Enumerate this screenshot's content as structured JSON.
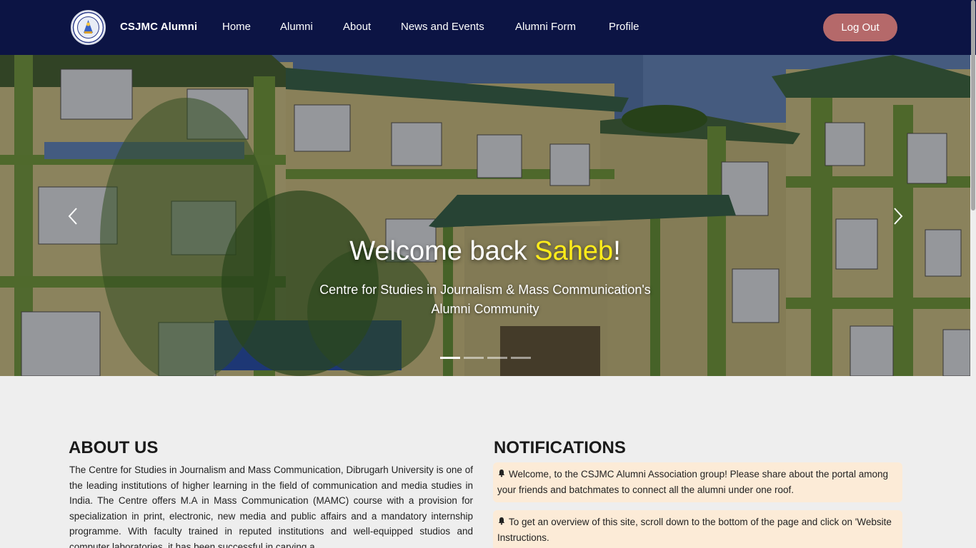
{
  "navbar": {
    "brand": "CSJMC Alumni",
    "links": [
      {
        "label": "Home"
      },
      {
        "label": "Alumni"
      },
      {
        "label": "About"
      },
      {
        "label": "News and Events"
      },
      {
        "label": "Alumni Form"
      },
      {
        "label": "Profile"
      }
    ],
    "logout_label": "Log Out"
  },
  "hero": {
    "welcome_prefix": "Welcome back ",
    "user_name": "Saheb",
    "welcome_suffix": "!",
    "subtitle_line1": "Centre for Studies in Journalism & Mass Communication's",
    "subtitle_line2": "Alumni Community",
    "slide_count": 4,
    "active_slide": 1
  },
  "about": {
    "title": "ABOUT US",
    "text": "The Centre for Studies in Journalism and Mass Communication, Dibrugarh University is one of the leading institutions of higher learning in the field of communication and media studies in India. The Centre offers M.A in Mass Communication (MAMC) course with a provision for specialization in print, electronic, new media and public affairs and a mandatory internship programme. With faculty trained in reputed institutions and well-equipped studios and computer laboratories, it has been successful in carving a"
  },
  "notifications": {
    "title": "NOTIFICATIONS",
    "items": [
      {
        "text": "Welcome, to the CSJMC Alumni Association group! Please share about the portal among your friends and batchmates to connect all the alumni under one roof."
      },
      {
        "text": "To get an overview of this site, scroll down to the bottom of the page and click on 'Website Instructions."
      }
    ]
  },
  "colors": {
    "navbar_bg": "#0c1444",
    "logout_bg": "#b5696a",
    "highlight_name": "#ffec1a",
    "notification_bg": "#fcebd7",
    "page_bg": "#eeeeee"
  }
}
